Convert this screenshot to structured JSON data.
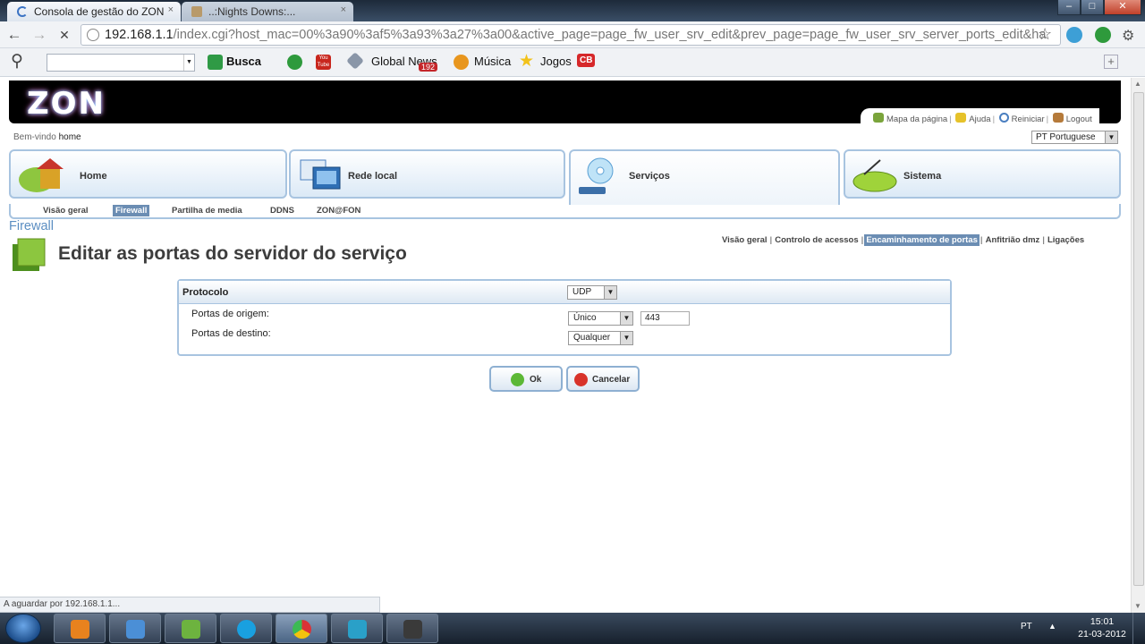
{
  "browser": {
    "tabs": [
      {
        "title": "Consola de gestão do ZON",
        "close": "×"
      },
      {
        "title": "..:Nights Downs:...",
        "close": "×"
      }
    ],
    "url_host": "192.168.1.1",
    "url_path": "/index.cgi?host_mac=00%3a90%3af5%3a93%3a27%3a00&active_page=page_fw_user_srv_edit&prev_page=page_fw_user_srv_server_ports_edit&ha",
    "window_controls": {
      "minimize": "–",
      "maximize": "□",
      "close": "✕"
    },
    "nav": {
      "back": "←",
      "forward": "→",
      "stop": "✕"
    },
    "star": "☆",
    "new_tab": "+"
  },
  "bookmarks": {
    "search_glyph": "⚲",
    "busca_label": "Busca",
    "global_news_label": "Global News",
    "global_news_badge": "192",
    "musica_label": "Música",
    "jogos_label": "Jogos",
    "cb_label": "CB",
    "youtube_label": "You\nTube"
  },
  "header": {
    "logo": "ZON",
    "utility_links": {
      "sitemap": "Mapa da página",
      "help": "Ajuda",
      "restart": "Reiniciar",
      "logout": "Logout"
    }
  },
  "welcome": {
    "prefix": "Bem-vindo",
    "user": "home"
  },
  "language": {
    "selected": "PT Portuguese"
  },
  "main_tabs": [
    {
      "label": "Home"
    },
    {
      "label": "Rede local"
    },
    {
      "label": "Serviços"
    },
    {
      "label": "Sistema"
    }
  ],
  "subnav": [
    "Visão geral",
    "Firewall",
    "Partilha de media",
    "DDNS",
    "ZON@FON"
  ],
  "section_title": "Firewall",
  "page_title": "Editar as portas do servidor do serviço",
  "section_nav": [
    "Visão geral",
    "Controlo de acessos",
    "Encaminhamento de portas",
    "Anfitrião dmz",
    "Ligações"
  ],
  "form": {
    "protocol_label": "Protocolo",
    "protocol_value": "UDP",
    "source_ports_label": "Portas de origem:",
    "source_ports_mode": "Único",
    "source_port_value": "443",
    "dest_ports_label": "Portas de destino:",
    "dest_ports_mode": "Qualquer"
  },
  "buttons": {
    "ok": "Ok",
    "cancel": "Cancelar"
  },
  "status_bar": "A aguardar por 192.168.1.1...",
  "taskbar": {
    "lang": "PT",
    "tray_arrow": "▲",
    "time": "15:01",
    "date": "21-03-2012"
  },
  "colors": {
    "accent_blue": "#a8c4e0",
    "active_nav": "#6b8db3",
    "section_title": "#5b8ec2"
  }
}
